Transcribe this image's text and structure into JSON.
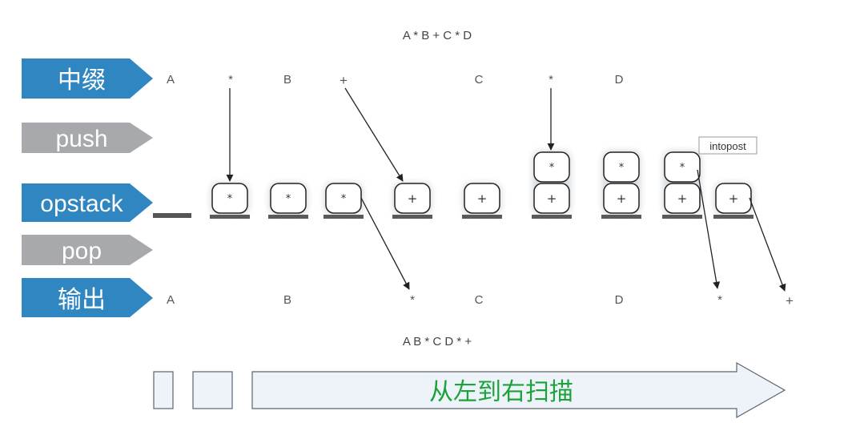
{
  "expressions": {
    "infix": "A * B + C * D",
    "postfix": "A B * C D * +"
  },
  "row_labels": {
    "infix": "中缀",
    "push": "push",
    "opstack": "opstack",
    "pop": "pop",
    "output": "输出"
  },
  "infix_tokens": [
    "A",
    "*",
    "B",
    "+",
    "C",
    "*",
    "D"
  ],
  "output_tokens": [
    "A",
    "B",
    "*",
    "C",
    "D",
    "*",
    "+"
  ],
  "stacks": [
    [],
    [
      "*"
    ],
    [
      "*"
    ],
    [
      "*"
    ],
    [
      "+"
    ],
    [
      "+"
    ],
    [
      "+",
      "*"
    ],
    [
      "+",
      "*"
    ],
    [
      "+",
      "*"
    ],
    [
      "+"
    ]
  ],
  "tooltip": "intopost",
  "scan_label": "从左到右扫描",
  "colors": {
    "blue_label": "#2f86c0",
    "gray_label": "#a7a9ac",
    "scan_text": "#1aa33a",
    "scan_fill": "#eef3f9",
    "scan_stroke": "#5b6470"
  }
}
